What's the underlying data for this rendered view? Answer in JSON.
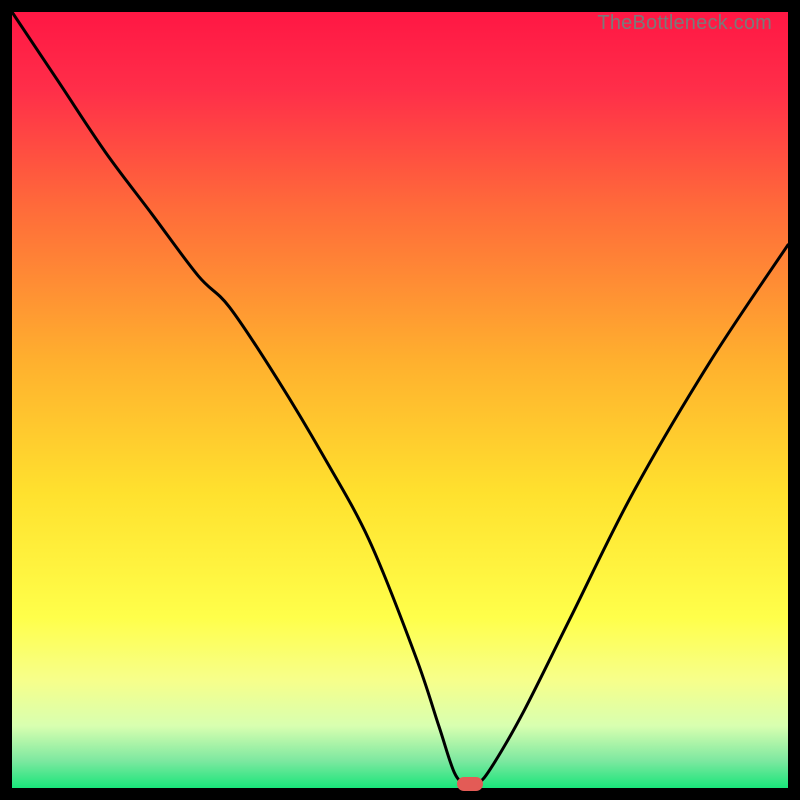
{
  "watermark": "TheBottleneck.com",
  "colors": {
    "curve": "#000000",
    "marker": "#e35b56",
    "gradient_stops": [
      {
        "offset": 0.0,
        "color": "#ff1744"
      },
      {
        "offset": 0.1,
        "color": "#ff2e49"
      },
      {
        "offset": 0.25,
        "color": "#ff6a3a"
      },
      {
        "offset": 0.45,
        "color": "#ffb02e"
      },
      {
        "offset": 0.62,
        "color": "#ffe12e"
      },
      {
        "offset": 0.78,
        "color": "#ffff4a"
      },
      {
        "offset": 0.86,
        "color": "#f7ff8a"
      },
      {
        "offset": 0.92,
        "color": "#d8ffb0"
      },
      {
        "offset": 0.965,
        "color": "#7de8a0"
      },
      {
        "offset": 1.0,
        "color": "#19e57a"
      }
    ]
  },
  "chart_data": {
    "type": "line",
    "title": "",
    "xlabel": "",
    "ylabel": "",
    "xlim": [
      0,
      100
    ],
    "ylim": [
      0,
      100
    ],
    "series": [
      {
        "name": "bottleneck-curve",
        "x": [
          0,
          6,
          12,
          18,
          24,
          28,
          34,
          40,
          46,
          52,
          55,
          57,
          58.5,
          60,
          62,
          66,
          72,
          80,
          90,
          100
        ],
        "y": [
          100,
          91,
          82,
          74,
          66,
          62,
          53,
          43,
          32,
          17,
          8,
          2,
          0.5,
          0.5,
          3,
          10,
          22,
          38,
          55,
          70
        ]
      }
    ],
    "annotations": [
      {
        "name": "optimum-marker",
        "x": 59,
        "y": 0.5
      }
    ]
  }
}
